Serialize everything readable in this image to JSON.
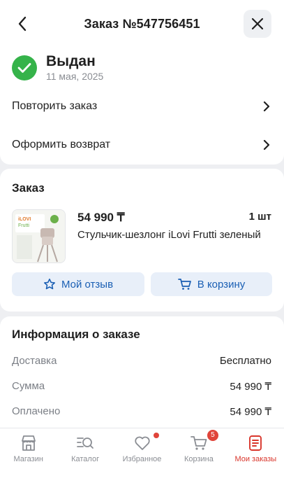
{
  "header": {
    "title": "Заказ №547756451"
  },
  "status": {
    "title": "Выдан",
    "date": "11 мая, 2025"
  },
  "actions": [
    {
      "label": "Повторить заказ"
    },
    {
      "label": "Оформить возврат"
    }
  ],
  "order": {
    "title": "Заказ",
    "product": {
      "price": "54 990 ₸",
      "qty": "1 шт",
      "name": "Стульчик-шезлонг iLovi Frutti зеленый",
      "image_brand": "iLOVI",
      "image_model": "Frutti"
    },
    "review_label": "Мой отзыв",
    "cart_label": "В корзину"
  },
  "info": {
    "title": "Информация о заказе",
    "rows": [
      {
        "label": "Доставка",
        "value": "Бесплатно"
      },
      {
        "label": "Сумма",
        "value": "54 990 ₸"
      },
      {
        "label": "Оплачено",
        "value": "54 990 ₸"
      }
    ]
  },
  "tabbar": {
    "items": [
      {
        "label": "Магазин",
        "icon": "shop-icon"
      },
      {
        "label": "Каталог",
        "icon": "catalog-search-icon"
      },
      {
        "label": "Избранное",
        "icon": "heart-icon"
      },
      {
        "label": "Корзина",
        "icon": "cart-icon",
        "badge": "5"
      },
      {
        "label": "Мои заказы",
        "icon": "orders-icon",
        "active": true
      }
    ]
  },
  "colors": {
    "accent": "#d9362c",
    "success": "#35b34a",
    "link": "#1a5fb4"
  }
}
